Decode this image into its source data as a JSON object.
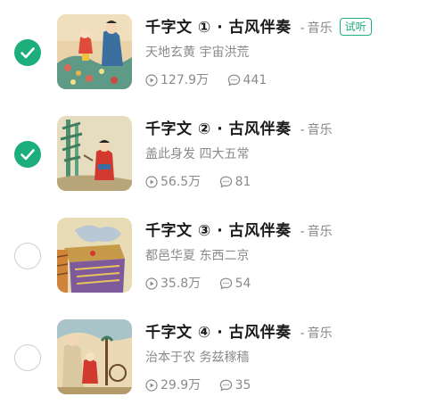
{
  "accent_color": "#1cae7b",
  "items": [
    {
      "selected": true,
      "title": "千字文 ① · 古风伴奏",
      "dash": "-",
      "category": "音乐",
      "badge": "试听",
      "subtitle": "天地玄黄 宇宙洪荒",
      "plays": "127.9万",
      "comments": "441",
      "play_icon": "play-count-icon",
      "comment_icon": "comment-icon"
    },
    {
      "selected": true,
      "title": "千字文 ② · 古风伴奏",
      "dash": "-",
      "category": "音乐",
      "badge": "",
      "subtitle": "盖此身发 四大五常",
      "plays": "56.5万",
      "comments": "81",
      "play_icon": "play-count-icon",
      "comment_icon": "comment-icon"
    },
    {
      "selected": false,
      "title": "千字文 ③ · 古风伴奏",
      "dash": "-",
      "category": "音乐",
      "badge": "",
      "subtitle": "都邑华夏 东西二京",
      "plays": "35.8万",
      "comments": "54",
      "play_icon": "play-count-icon",
      "comment_icon": "comment-icon"
    },
    {
      "selected": false,
      "title": "千字文 ④ · 古风伴奏",
      "dash": "-",
      "category": "音乐",
      "badge": "",
      "subtitle": "治本于农 务兹稼穑",
      "plays": "29.9万",
      "comments": "35",
      "play_icon": "play-count-icon",
      "comment_icon": "comment-icon"
    }
  ]
}
